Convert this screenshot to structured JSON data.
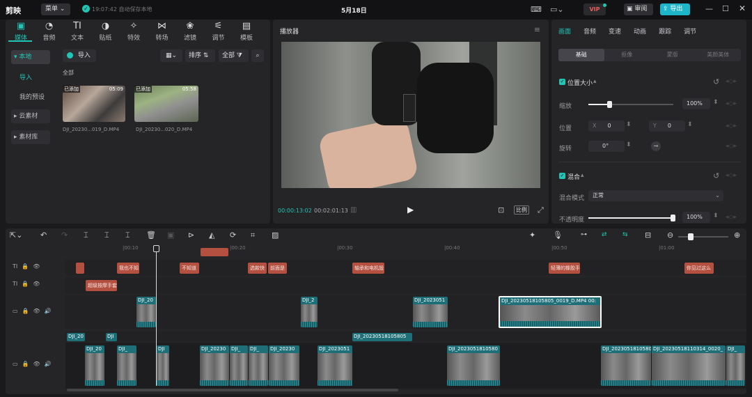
{
  "app": {
    "logo": "剪映",
    "menu_label": "菜单",
    "autosave": "19:07:42 自动保存本地",
    "title": "5月18日",
    "vip_label": "VIP",
    "review_label": "审阅",
    "export_label": "导出"
  },
  "media_tabs": [
    {
      "label": "媒体",
      "icon": "▣"
    },
    {
      "label": "音频",
      "icon": "◔"
    },
    {
      "label": "文本",
      "icon": "TI"
    },
    {
      "label": "贴纸",
      "icon": "◑"
    },
    {
      "label": "特效",
      "icon": "✧"
    },
    {
      "label": "转场",
      "icon": "⋈"
    },
    {
      "label": "滤镜",
      "icon": "❀"
    },
    {
      "label": "调节",
      "icon": "⚟"
    },
    {
      "label": "模板",
      "icon": "▤"
    }
  ],
  "sidebar": {
    "local": "▾ 本地",
    "import": "导入",
    "presets": "我的预设",
    "cloud": "▸ 云素材",
    "library": "▸ 素材库"
  },
  "media": {
    "import_button": "导入",
    "sort_label": "排序",
    "filter_label": "全部",
    "section_label": "全部",
    "items": [
      {
        "badge": "已添加",
        "duration": "05:09",
        "name": "DJI_20230...019_D.MP4"
      },
      {
        "badge": "已添加",
        "duration": "05:58",
        "name": "DJI_20230...020_D.MP4"
      }
    ]
  },
  "player": {
    "title": "播放器",
    "current_time": "00:00:13:02",
    "total_time": "00:02:01:13",
    "ratio_label": "比例"
  },
  "inspector": {
    "tabs": [
      "画面",
      "音频",
      "变速",
      "动画",
      "跟踪",
      "调节"
    ],
    "subtabs": [
      "基础",
      "抠像",
      "蒙版",
      "美颜美体"
    ],
    "position_size": "位置大小",
    "scale_label": "缩放",
    "scale_value": "100%",
    "scale_level": 0.25,
    "position_label": "位置",
    "x_label": "X",
    "x_value": "0",
    "y_label": "Y",
    "y_value": "0",
    "rotate_label": "旋转",
    "rotate_value": "0°",
    "blend_title": "混合",
    "blend_mode_label": "混合模式",
    "blend_mode_value": "正常",
    "opacity_label": "不透明度",
    "opacity_value": "100%",
    "opacity_level": 1.0
  },
  "timeline": {
    "ruler": [
      "|00:10",
      "|00:20",
      "|00:30",
      "|00:40",
      "|00:50",
      "|01:00"
    ],
    "text_clips_row1": [
      "",
      "我也不知",
      "不知道",
      "选款快",
      "前面是",
      "轴承和电机設",
      "轻薄的橡胶手",
      "你见过这么"
    ],
    "text_clips_row2": [
      "超级按摩手套"
    ],
    "video_clips_upper": [
      "DJI_20",
      "DJI_2",
      "DJI_2023051",
      "DJI_20230518105805_0019_D.MP4   00:"
    ],
    "video_clips_lower_labels": [
      "DJI_20",
      "DJI",
      "DJI_20230518105805"
    ],
    "main_clips": [
      "DJI_20",
      "DJI_",
      "DJI",
      "DJI_20230",
      "DJI_",
      "DJI_",
      "DJI_20230",
      "DJI_2023051",
      "DJI_2023051810580",
      "DJI_2023051810580",
      "DJI_20230518110314_0020_",
      "DJI_"
    ]
  }
}
